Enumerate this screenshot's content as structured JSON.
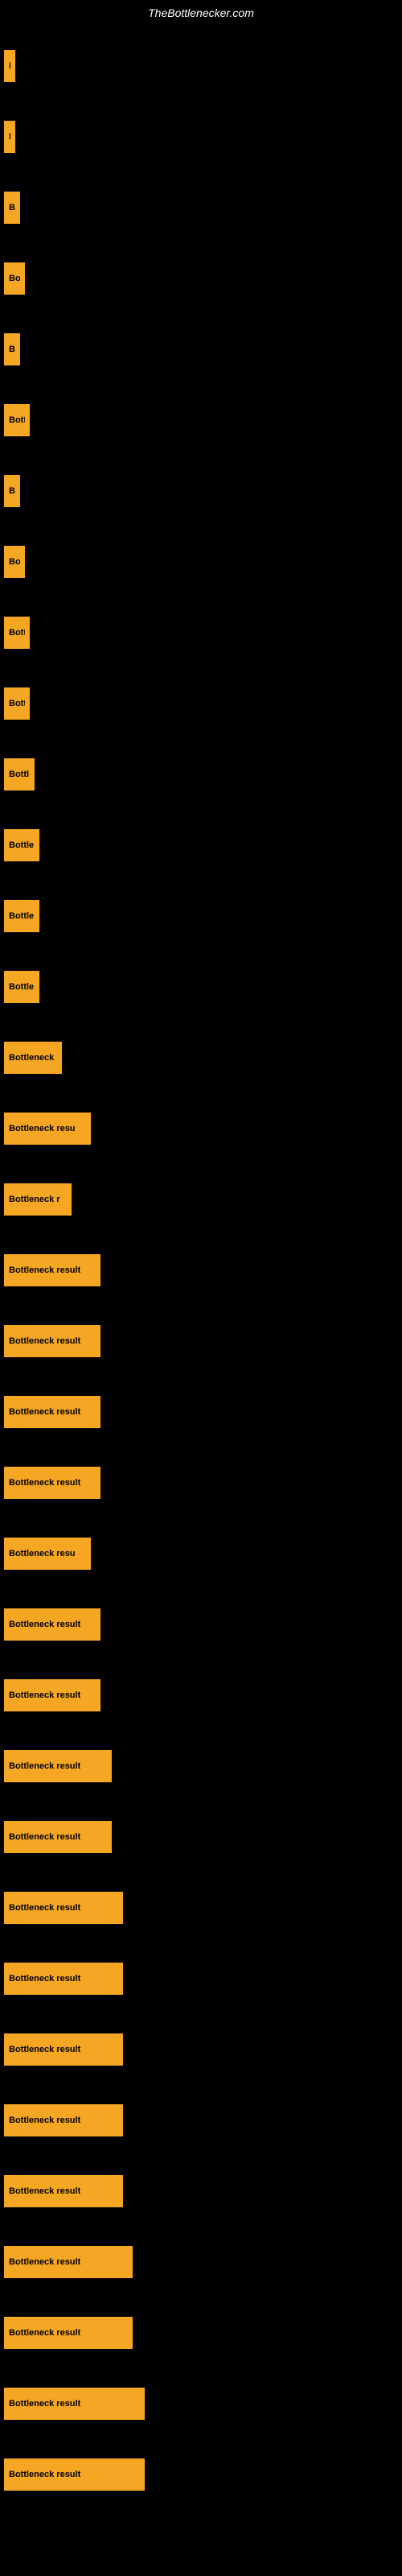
{
  "site": {
    "title": "TheBottlenecker.com"
  },
  "bars": [
    {
      "label": "B",
      "width": 14
    },
    {
      "label": "B",
      "width": 14
    },
    {
      "label": "Bo",
      "width": 20
    },
    {
      "label": "Bot",
      "width": 26
    },
    {
      "label": "Bo",
      "width": 20
    },
    {
      "label": "Bott",
      "width": 32
    },
    {
      "label": "Bo",
      "width": 20
    },
    {
      "label": "Bot",
      "width": 26
    },
    {
      "label": "Bott",
      "width": 32
    },
    {
      "label": "Bott",
      "width": 32
    },
    {
      "label": "Bottl",
      "width": 38
    },
    {
      "label": "Bottle",
      "width": 44
    },
    {
      "label": "Bottle",
      "width": 44
    },
    {
      "label": "Bottle",
      "width": 44
    },
    {
      "label": "Bottleneck",
      "width": 72
    },
    {
      "label": "Bottleneck resu",
      "width": 108
    },
    {
      "label": "Bottleneck r",
      "width": 84
    },
    {
      "label": "Bottleneck result",
      "width": 120
    },
    {
      "label": "Bottleneck result",
      "width": 120
    },
    {
      "label": "Bottleneck result",
      "width": 120
    },
    {
      "label": "Bottleneck result",
      "width": 120
    },
    {
      "label": "Bottleneck resu",
      "width": 108
    },
    {
      "label": "Bottleneck result",
      "width": 120
    },
    {
      "label": "Bottleneck result",
      "width": 120
    },
    {
      "label": "Bottleneck result",
      "width": 134
    },
    {
      "label": "Bottleneck result",
      "width": 134
    },
    {
      "label": "Bottleneck result",
      "width": 148
    },
    {
      "label": "Bottleneck result",
      "width": 148
    },
    {
      "label": "Bottleneck result",
      "width": 148
    },
    {
      "label": "Bottleneck result",
      "width": 148
    },
    {
      "label": "Bottleneck result",
      "width": 148
    },
    {
      "label": "Bottleneck result",
      "width": 160
    },
    {
      "label": "Bottleneck result",
      "width": 160
    },
    {
      "label": "Bottleneck result",
      "width": 175
    },
    {
      "label": "Bottleneck result",
      "width": 175
    }
  ]
}
